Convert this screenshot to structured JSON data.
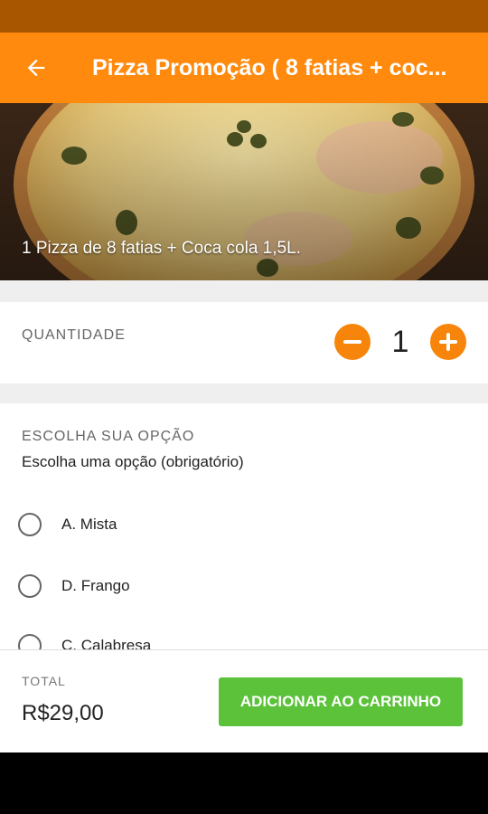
{
  "header": {
    "title": "Pizza Promoção ( 8 fatias + coc...",
    "back_icon": "arrow-left-icon"
  },
  "hero": {
    "caption": "1 Pizza de 8 fatias + Coca cola 1,5L."
  },
  "quantity": {
    "label": "QUANTIDADE",
    "value": "1",
    "decrement_icon": "minus-icon",
    "increment_icon": "plus-icon"
  },
  "options": {
    "title": "ESCOLHA SUA OPÇÃO",
    "subtitle": "Escolha uma opção (obrigatório)",
    "items": [
      {
        "label": "A. Mista"
      },
      {
        "label": "D. Frango"
      },
      {
        "label": "C. Calabresa"
      }
    ]
  },
  "footer": {
    "total_label": "TOTAL",
    "total_value": "R$29,00",
    "cart_button": "ADICIONAR AO CARRINHO"
  },
  "colors": {
    "status_bar": "#a85600",
    "app_bar": "#ff8a0e",
    "accent": "#f7850b",
    "cart_button": "#5bc23a"
  }
}
